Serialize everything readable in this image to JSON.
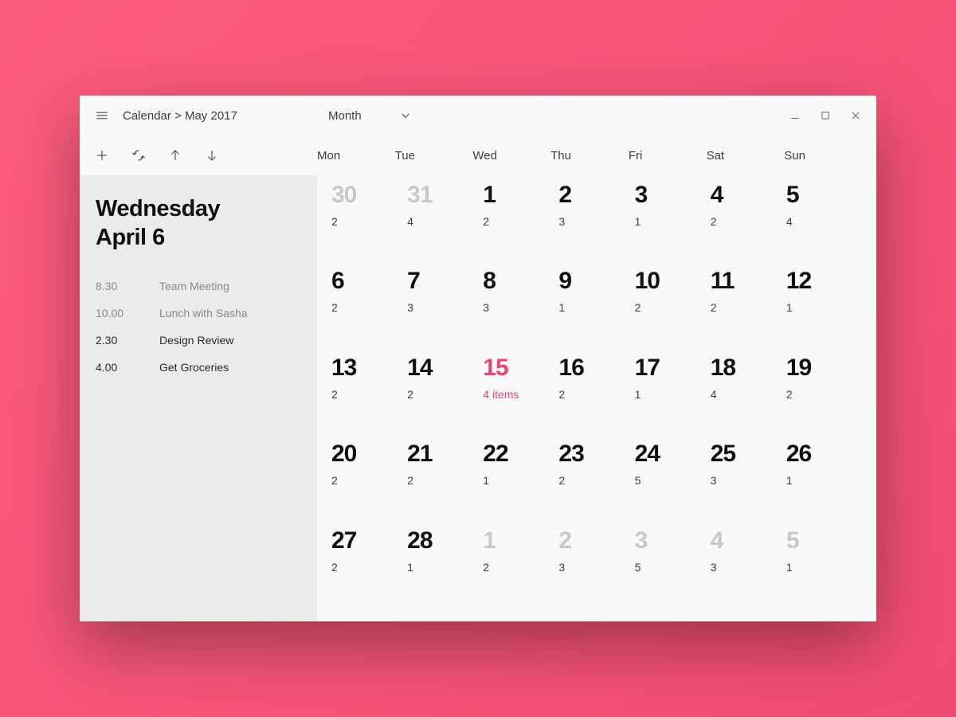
{
  "colors": {
    "accent": "#f0426d"
  },
  "header": {
    "breadcrumb": "Calendar > May 2017",
    "view_selector_label": "Month",
    "day_names": [
      "Mon",
      "Tue",
      "Wed",
      "Thu",
      "Fri",
      "Sat",
      "Sun"
    ]
  },
  "sidebar": {
    "title_line1": "Wednesday",
    "title_line2": "April 6",
    "agenda": [
      {
        "time": "8.30",
        "label": "Team Meeting",
        "emphasis": "muted"
      },
      {
        "time": "10.00",
        "label": "Lunch with Sasha",
        "emphasis": "muted"
      },
      {
        "time": "2.30",
        "label": "Design Review",
        "emphasis": "strong"
      },
      {
        "time": "4.00",
        "label": "Get Groceries",
        "emphasis": "strong"
      }
    ]
  },
  "calendar": {
    "cells": [
      {
        "day": "30",
        "count": "2",
        "out_of_month": true
      },
      {
        "day": "31",
        "count": "4",
        "out_of_month": true
      },
      {
        "day": "1",
        "count": "2"
      },
      {
        "day": "2",
        "count": "3"
      },
      {
        "day": "3",
        "count": "1"
      },
      {
        "day": "4",
        "count": "2"
      },
      {
        "day": "5",
        "count": "4"
      },
      {
        "day": "6",
        "count": "2"
      },
      {
        "day": "7",
        "count": "3"
      },
      {
        "day": "8",
        "count": "3"
      },
      {
        "day": "9",
        "count": "1"
      },
      {
        "day": "10",
        "count": "2"
      },
      {
        "day": "11",
        "count": "2"
      },
      {
        "day": "12",
        "count": "1"
      },
      {
        "day": "13",
        "count": "2"
      },
      {
        "day": "14",
        "count": "2"
      },
      {
        "day": "15",
        "count": "4 items",
        "today": true
      },
      {
        "day": "16",
        "count": "2"
      },
      {
        "day": "17",
        "count": "1"
      },
      {
        "day": "18",
        "count": "4"
      },
      {
        "day": "19",
        "count": "2"
      },
      {
        "day": "20",
        "count": "2"
      },
      {
        "day": "21",
        "count": "2"
      },
      {
        "day": "22",
        "count": "1"
      },
      {
        "day": "23",
        "count": "2"
      },
      {
        "day": "24",
        "count": "5"
      },
      {
        "day": "25",
        "count": "3"
      },
      {
        "day": "26",
        "count": "1"
      },
      {
        "day": "27",
        "count": "2"
      },
      {
        "day": "28",
        "count": "1"
      },
      {
        "day": "1",
        "count": "2",
        "out_of_month": true
      },
      {
        "day": "2",
        "count": "3",
        "out_of_month": true
      },
      {
        "day": "3",
        "count": "5",
        "out_of_month": true
      },
      {
        "day": "4",
        "count": "3",
        "out_of_month": true
      },
      {
        "day": "5",
        "count": "1",
        "out_of_month": true
      }
    ]
  }
}
